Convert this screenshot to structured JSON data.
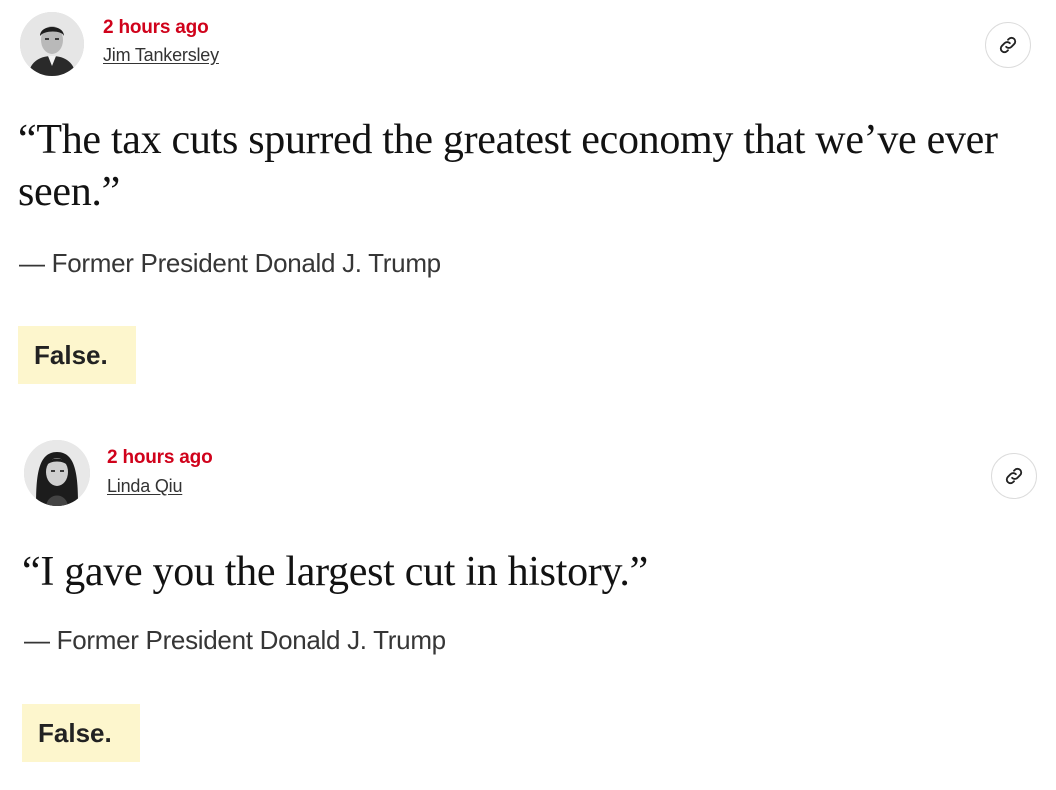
{
  "posts": [
    {
      "timestamp": "2 hours ago",
      "author": "Jim Tankersley",
      "quote": "“The tax cuts spurred the greatest economy that we’ve ever seen.”",
      "attribution": "— Former President Donald J. Trump",
      "verdict": "False.",
      "link_icon": "link-icon"
    },
    {
      "timestamp": "2 hours ago",
      "author": "Linda Qiu",
      "quote": "“I gave you the largest cut in history.”",
      "attribution": "— Former President Donald J. Trump",
      "verdict": "False.",
      "link_icon": "link-icon"
    }
  ],
  "colors": {
    "timestamp": "#d0021b",
    "verdict_bg": "#fdf6cd",
    "text": "#121212"
  }
}
